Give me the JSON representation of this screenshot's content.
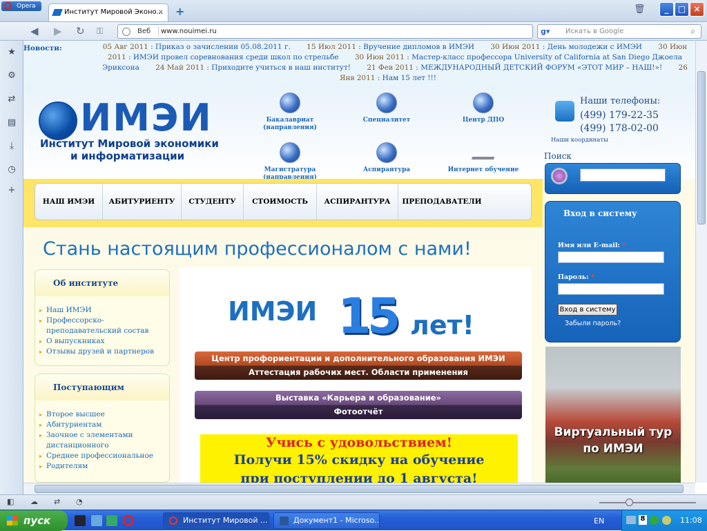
{
  "browser": {
    "menu_label": "Opera",
    "tab_title": "Институт Мировой Эконо...",
    "tab_close": "×",
    "new_tab": "+",
    "address_prefix": "Веб",
    "url": "www.nouimei.ru",
    "search_engine_icon": "google-icon",
    "search_placeholder": "Искать в Google",
    "window_buttons": [
      "_",
      "□",
      "×"
    ]
  },
  "news": {
    "label": "Новости:",
    "items": [
      {
        "date": "05 Авг 2011",
        "text": "Приказ о зачислении 05.08.2011 г."
      },
      {
        "date": "15 Июл 2011",
        "text": "Вручение дипломов в ИМЭИ"
      },
      {
        "date": "30 Июн 2011",
        "text": "День молодежи с ИМЭИ"
      },
      {
        "date": "30 Июн 2011",
        "text": "ИМЭИ провел соревнования среди школ по стрельбе"
      },
      {
        "date": "30 Июн 2011",
        "text": "Мастер-класс профессора University of California at San Diego Джоела Эриксона"
      },
      {
        "date": "24 Май 2011",
        "text": "Приходите учиться в наш институт!"
      },
      {
        "date": "21 Фев 2011",
        "text": "МЕЖДУНАРОДНЫЙ ДЕТСКИЙ ФОРУМ «ЭТОТ МИР – НАШ!»!"
      },
      {
        "date": "26 Янв 2011",
        "text": "Нам 15 лет !!!"
      }
    ]
  },
  "logo": {
    "title": "ИМЭИ",
    "subtitle_line1": "Институт Мировой экономики",
    "subtitle_line2": "и информатизации"
  },
  "programs": [
    {
      "label": "Бакалавриат (направления)"
    },
    {
      "label": "Специалитет"
    },
    {
      "label": "Центр ДПО"
    },
    {
      "label": "Магистратура (направления)"
    },
    {
      "label": "Аспирантура"
    },
    {
      "label": "Интернет обучение"
    }
  ],
  "contacts": {
    "title": "Наши телефоны:",
    "phone1": "(499) 179-22-35",
    "phone2": "(499) 178-02-00",
    "coords_link": "Наши координаты"
  },
  "search": {
    "label": "Поиск"
  },
  "menu": [
    "НАШ ИМЭИ",
    "АБИТУРИЕНТУ",
    "СТУДЕНТУ",
    "СТОИМОСТЬ",
    "АСПИРАНТУРА",
    "ПРЕПОДАВАТЕЛИ"
  ],
  "headline": "Стань настоящим профессионалом с нами!",
  "about_panel": {
    "title": "Об институте",
    "links": [
      "Наш ИМЭИ",
      "Профессорско-преподавательский состав",
      "О выпускниках",
      "Отзывы друзей и партнеров"
    ]
  },
  "applicants_panel": {
    "title": "Поступающим",
    "links": [
      "Второе высшее",
      "Абитуриентам",
      "Заочное с элементами дистанционного",
      "Среднее профессиональное",
      "Родителям"
    ]
  },
  "anniversary": {
    "left": "ИМЭИ",
    "number": "15",
    "right": "лет!"
  },
  "banners": [
    {
      "line1": "Центр профориентации и дополнительного образования ИМЭИ",
      "line2": "Аттестация рабочих мест. Области применения",
      "color": "#c85a2a"
    },
    {
      "line1": "Выставка «Карьера и образование»",
      "line2": "Фотоотчёт",
      "color": "#6a4a7a"
    }
  ],
  "promo": {
    "line1": "Учись с удовольствием!",
    "line2": "Получи 15% скидку на обучение",
    "line3": "при поступлении до 1 августа!"
  },
  "login": {
    "title": "Вход в систему",
    "user_label": "Имя или E-mail:",
    "password_label": "Пароль:",
    "required_mark": "*",
    "submit": "Вход в систему",
    "forgot": "Забыли пароль?"
  },
  "virtual_tour": {
    "line1": "Виртуальный тур",
    "line2": "по ИМЭИ"
  },
  "taskbar": {
    "start": "пуск",
    "windows": [
      "Институт Мировой ...",
      "Документ1 - Microso..."
    ],
    "lang": "EN",
    "clock": "11:08"
  }
}
